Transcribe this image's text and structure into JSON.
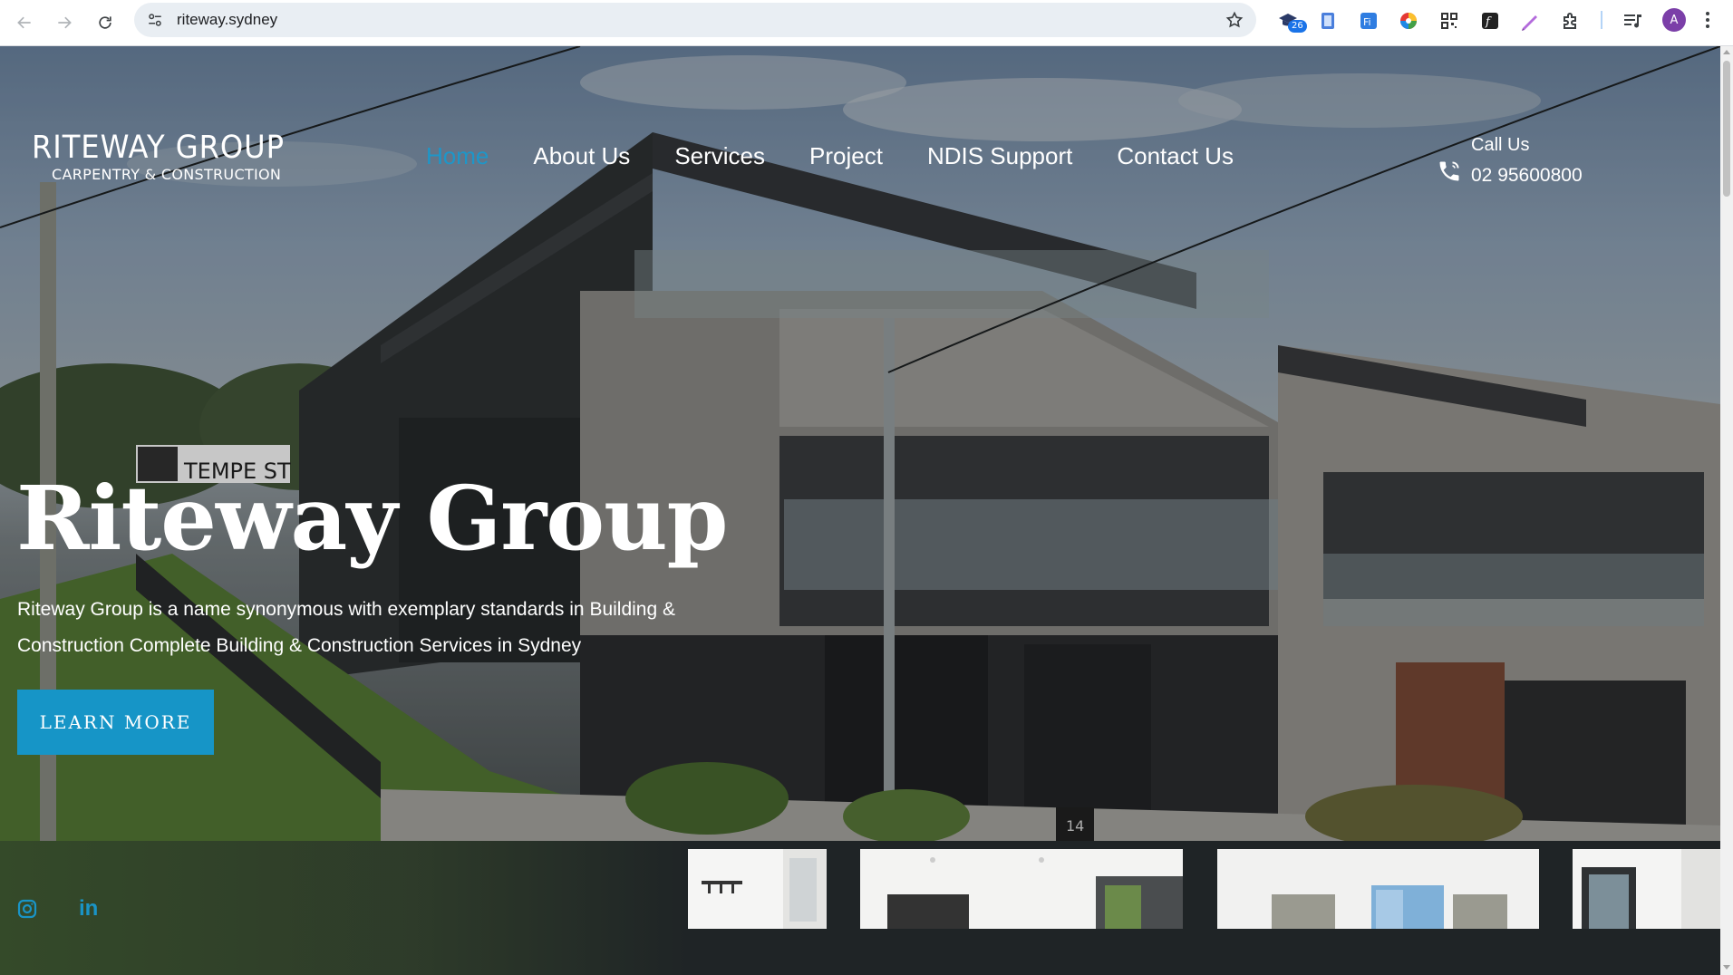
{
  "browser": {
    "url": "riteway.sydney",
    "extension_badge": "26",
    "profile_initial": "A"
  },
  "site": {
    "logo": {
      "main": "RITEWAY GROUP",
      "sub": "CARPENTRY & CONSTRUCTION"
    },
    "nav": [
      {
        "label": "Home",
        "active": true
      },
      {
        "label": "About Us"
      },
      {
        "label": "Services"
      },
      {
        "label": "Project"
      },
      {
        "label": "NDIS Support"
      },
      {
        "label": "Contact Us"
      }
    ],
    "call": {
      "label": "Call Us",
      "number": "02 95600800"
    }
  },
  "hero": {
    "title": "Riteway Group",
    "description": "Riteway Group is a name synonymous with exemplary standards in Building & Construction Complete Building & Construction Services in Sydney",
    "button_label": "LEARN MORE",
    "street_sign": "TEMPE ST",
    "house_number": "14"
  },
  "colors": {
    "accent": "#1695c7",
    "nav_active": "#1e96c8",
    "strip": "#1f2426"
  },
  "icons": {
    "social": [
      "instagram-icon",
      "linkedin-icon"
    ]
  }
}
